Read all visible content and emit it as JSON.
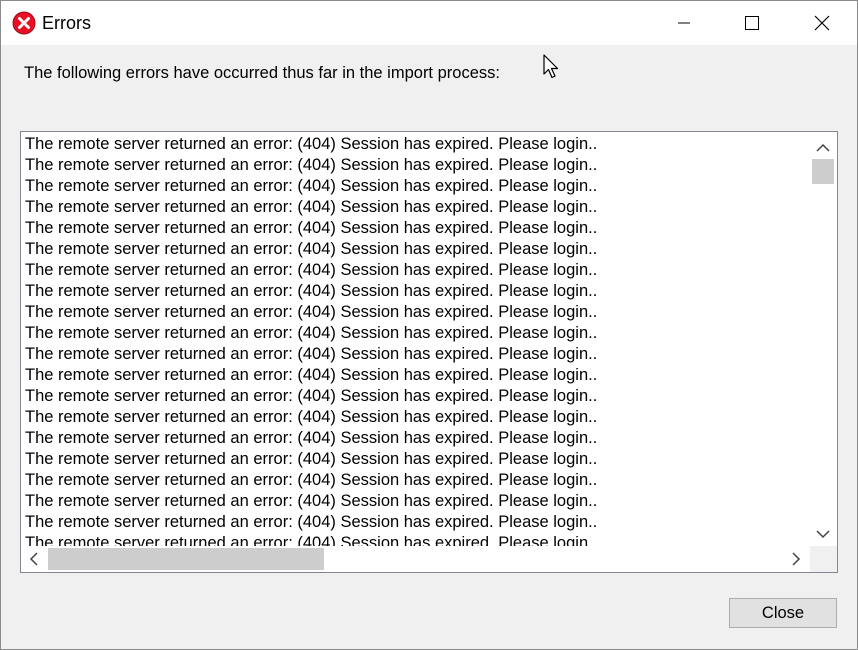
{
  "window": {
    "title": "Errors",
    "icon": "error-icon",
    "controls": [
      "minimize-icon",
      "maximize-icon",
      "close-icon"
    ]
  },
  "message": "The following errors have occurred thus far in the import process:",
  "errors": [
    "The remote server returned an error: (404) Session has expired. Please login..",
    "The remote server returned an error: (404) Session has expired. Please login..",
    "The remote server returned an error: (404) Session has expired. Please login..",
    "The remote server returned an error: (404) Session has expired. Please login..",
    "The remote server returned an error: (404) Session has expired. Please login..",
    "The remote server returned an error: (404) Session has expired. Please login..",
    "The remote server returned an error: (404) Session has expired. Please login..",
    "The remote server returned an error: (404) Session has expired. Please login..",
    "The remote server returned an error: (404) Session has expired. Please login..",
    "The remote server returned an error: (404) Session has expired. Please login..",
    "The remote server returned an error: (404) Session has expired. Please login..",
    "The remote server returned an error: (404) Session has expired. Please login..",
    "The remote server returned an error: (404) Session has expired. Please login..",
    "The remote server returned an error: (404) Session has expired. Please login..",
    "The remote server returned an error: (404) Session has expired. Please login..",
    "The remote server returned an error: (404) Session has expired. Please login..",
    "The remote server returned an error: (404) Session has expired. Please login..",
    "The remote server returned an error: (404) Session has expired. Please login..",
    "The remote server returned an error: (404) Session has expired. Please login..",
    "The remote server returned an error: (404) Session has expired. Please login.."
  ],
  "buttons": {
    "close_label": "Close"
  },
  "colors": {
    "error_red": "#e81123",
    "scroll_thumb": "#cdcdcd",
    "button_bg": "#e1e1e1"
  }
}
